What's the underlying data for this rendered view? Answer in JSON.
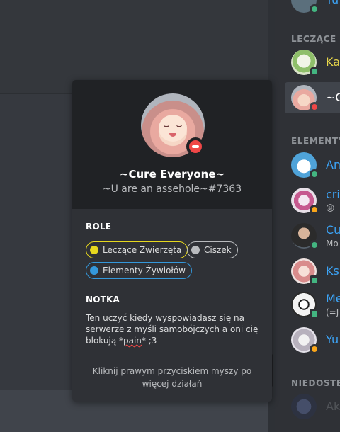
{
  "member_list": {
    "top_partial_name": "Yu",
    "groups": [
      {
        "header": "LECZĄCE Z",
        "members": [
          {
            "name": "Ka",
            "sub": "",
            "name_color": "#e8d74b",
            "status": "online",
            "selected": false
          },
          {
            "name": "~C",
            "sub": "",
            "name_color": "#ffffff",
            "status": "dnd",
            "selected": true
          }
        ]
      },
      {
        "header": "ELEMENTY",
        "members": [
          {
            "name": "Am",
            "sub": "",
            "name_color": "#3ca3f5",
            "status": "online",
            "selected": false
          },
          {
            "name": "cri",
            "sub": "😝",
            "name_color": "#3ca3f5",
            "status": "idle",
            "selected": false
          },
          {
            "name": "Cu",
            "sub": "Mo",
            "name_color": "#3ca3f5",
            "status": "online",
            "selected": false
          },
          {
            "name": "Ks",
            "sub": "",
            "name_color": "#3ca3f5",
            "status": "online",
            "selected": false
          },
          {
            "name": "Me",
            "sub": "(=J",
            "name_color": "#3ca3f5",
            "status": "online",
            "selected": false
          },
          {
            "name": "Yu",
            "sub": "",
            "name_color": "#3ca3f5",
            "status": "idle",
            "selected": false
          }
        ]
      },
      {
        "header": "NIEDOSTĘ",
        "members": [
          {
            "name": "Ak",
            "sub": "",
            "name_color": "#5d6269",
            "status": "",
            "selected": false
          }
        ]
      }
    ]
  },
  "profile_popout": {
    "username": "~Cure Everyone~",
    "tag": "~U are an assehole~#7363",
    "status": "dnd",
    "roles_title": "ROLE",
    "roles": [
      {
        "label": "Leczące Zwierzęta",
        "color": "#e7d81e"
      },
      {
        "label": "Ciszek",
        "color": "#b9bbbe"
      },
      {
        "label": "Elementy Żywiołów",
        "color": "#3498db"
      }
    ],
    "note_title": "NOTKA",
    "note_before": "Ten uczyć kiedy wyspowiadasz się na serwerze z myśli samobójczych a oni cię blokują *",
    "note_misspelled": "pain",
    "note_after": "* ;3",
    "hint": "Kliknij prawym przyciskiem myszy po więcej działań"
  },
  "colors": {
    "background": "#36393f",
    "popout_header": "#202225",
    "popout_body": "#2f3136",
    "member_list": "#2f3136",
    "dnd": "#f04747",
    "online": "#43b581",
    "idle": "#faa61a"
  }
}
